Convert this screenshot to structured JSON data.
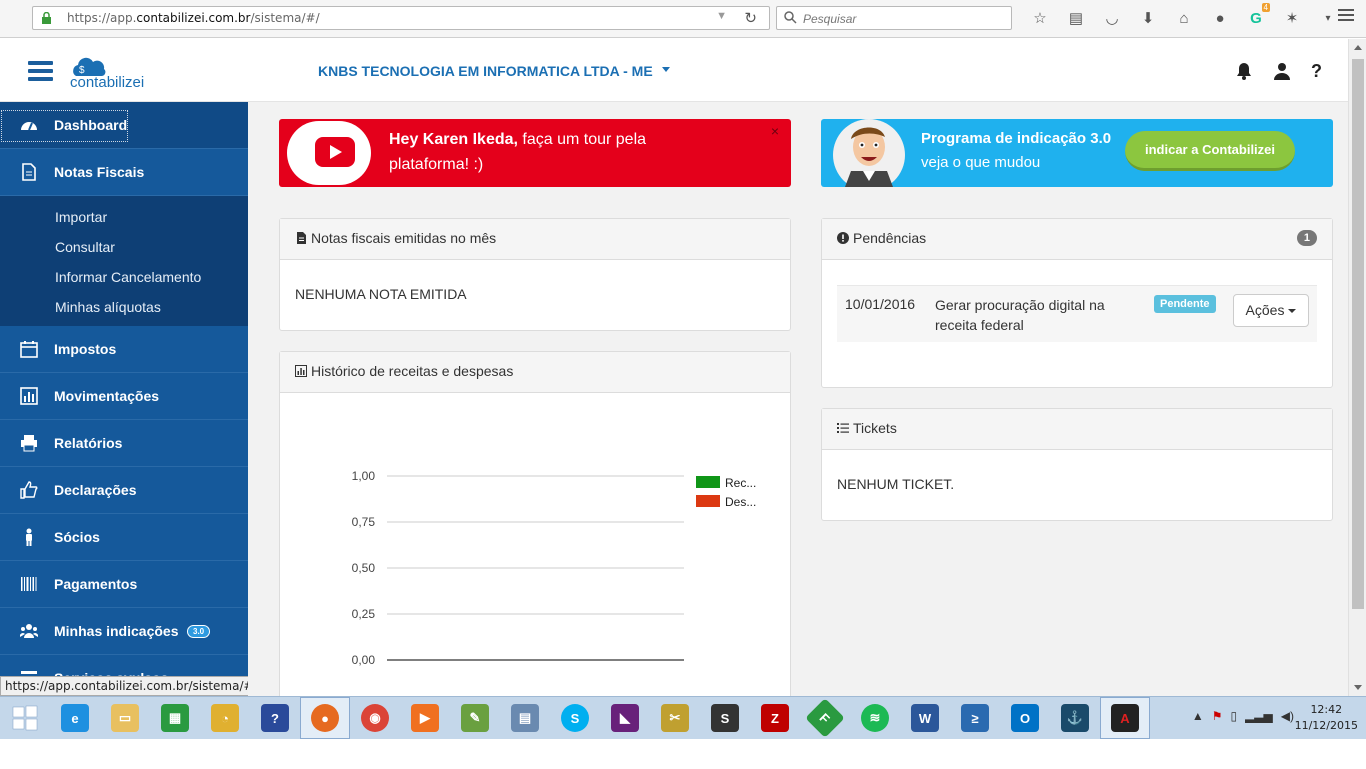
{
  "browser": {
    "url_prefix": "https://app.",
    "url_domain": "contabilizei.com.br",
    "url_path": "/sistema/#/",
    "search_placeholder": "Pesquisar",
    "badge_count": "4",
    "status_url": "https://app.contabilizei.com.br/sistema/#"
  },
  "header": {
    "logo_text": "contabilizei",
    "company": "KNBS TECNOLOGIA EM INFORMATICA LTDA - ME",
    "help": "?"
  },
  "sidebar": {
    "items": [
      {
        "label": "Dashboard",
        "icon": "dashboard-icon"
      },
      {
        "label": "Notas Fiscais",
        "icon": "file-icon"
      },
      {
        "label": "Impostos",
        "icon": "calendar-icon"
      },
      {
        "label": "Movimentações",
        "icon": "bar-chart-icon"
      },
      {
        "label": "Relatórios",
        "icon": "print-icon"
      },
      {
        "label": "Declarações",
        "icon": "thumbs-up-icon"
      },
      {
        "label": "Sócios",
        "icon": "person-icon"
      },
      {
        "label": "Pagamentos",
        "icon": "barcode-icon"
      },
      {
        "label": "Minhas indicações",
        "icon": "users-icon",
        "badge": "3.0"
      },
      {
        "label": "Serviços avulsos",
        "icon": "list-icon"
      }
    ],
    "sub_items": [
      "Importar",
      "Consultar",
      "Informar Cancelamento",
      "Minhas alíquotas"
    ]
  },
  "banners": {
    "tour_name": "Hey Karen Ikeda,",
    "tour_rest": " faça um tour pela plataforma! :)",
    "tour_close": "×",
    "indication_line1": "Programa de indicação 3.0",
    "indication_line2": "veja o que mudou",
    "indication_button": "indicar a Contabilizei"
  },
  "notas": {
    "title": "Notas fiscais emitidas no mês",
    "empty": "NENHUMA NOTA EMITIDA"
  },
  "historico": {
    "title": "Histórico de receitas e despesas"
  },
  "pendencias": {
    "title": "Pendências",
    "count": "1",
    "rows": [
      {
        "date": "10/01/2016",
        "description": "Gerar procuração digital na receita federal",
        "status": "Pendente",
        "action": "Ações"
      }
    ]
  },
  "tickets": {
    "title": "Tickets",
    "empty": "NENHUM TICKET."
  },
  "chart_data": {
    "type": "bar",
    "categories": [],
    "series": [
      {
        "name": "Rec...",
        "color": "#109618",
        "values": []
      },
      {
        "name": "Des...",
        "color": "#dc3912",
        "values": []
      }
    ],
    "ylim": [
      0,
      1
    ],
    "yticks": [
      "1,00",
      "0,75",
      "0,50",
      "0,25",
      "0,00"
    ],
    "legend": "right"
  },
  "taskbar": {
    "time": "12:42",
    "date": "11/12/2015"
  }
}
